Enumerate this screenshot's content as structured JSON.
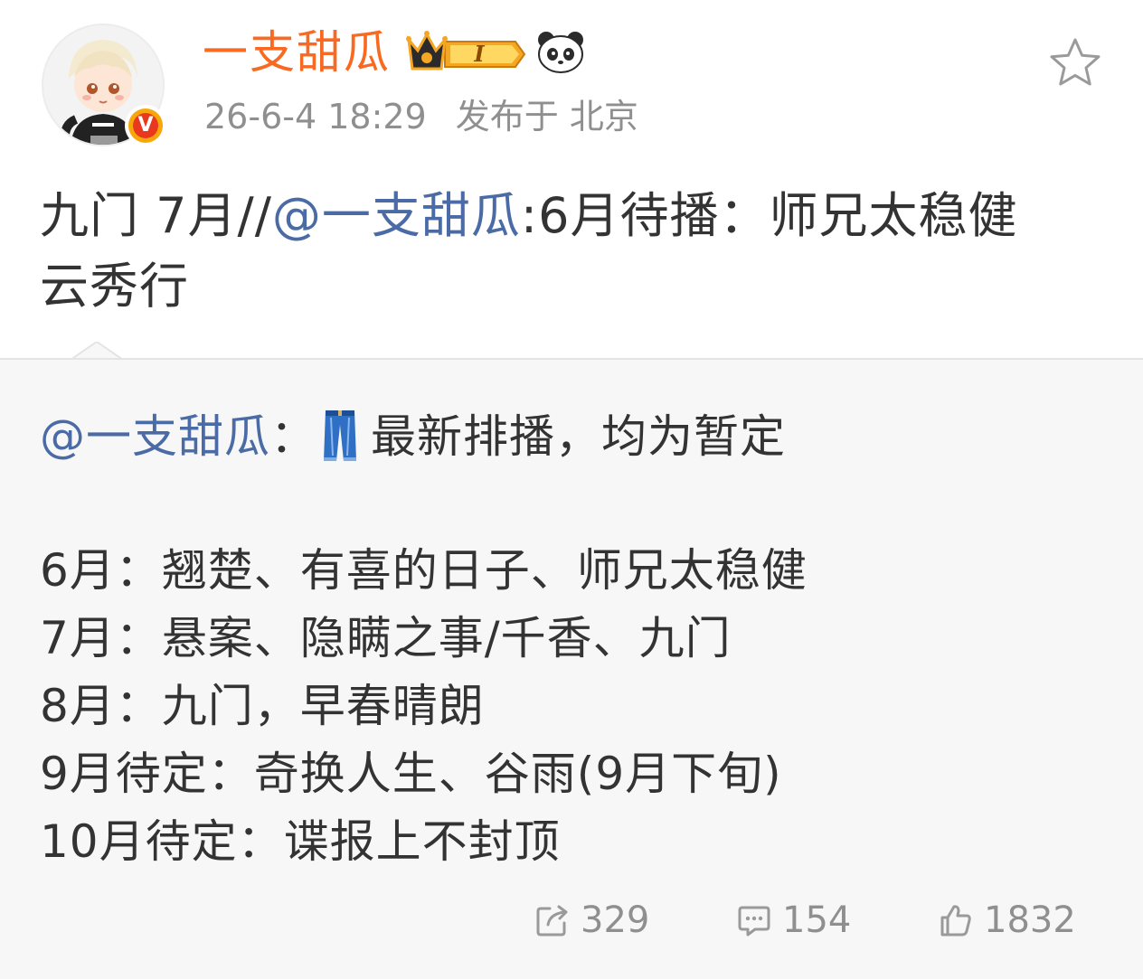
{
  "author": {
    "name": "一支甜瓜",
    "vip_level": "I",
    "verified_mark": "V",
    "time": "26-6-4 18:29",
    "location": "发布于 北京"
  },
  "post": {
    "prefix": "九门 7月//",
    "mention": "@一支甜瓜",
    "line1_rest": ":6月待播：师兄太稳健",
    "line2": "云秀行"
  },
  "repost": {
    "mention": "@一支甜瓜",
    "separator": "：",
    "emoji_name": "jeans-icon",
    "head_text": "最新排播，均为暂定",
    "lines": [
      "6月：翘楚、有喜的日子、师兄太稳健",
      "7月：悬案、隐瞒之事/千香、九门",
      "8月：九门，早春晴朗",
      "9月待定：奇换人生、谷雨(9月下旬)",
      "10月待定：谍报上不封顶"
    ],
    "actions": {
      "share_count": "329",
      "comment_count": "154",
      "like_count": "1832"
    }
  },
  "colors": {
    "name": "#f86a22",
    "mention": "#4a6ba5",
    "meta": "#8f8f8f",
    "repost_bg": "#f7f7f7"
  }
}
